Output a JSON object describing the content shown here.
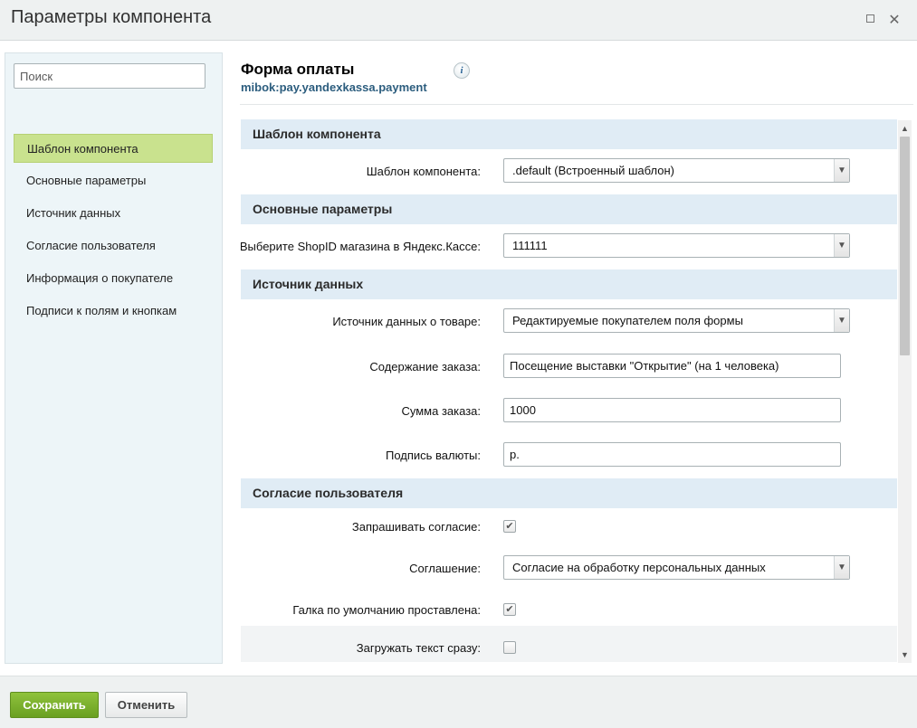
{
  "window": {
    "title": "Параметры компонента"
  },
  "sidebar": {
    "search_placeholder": "Поиск",
    "items": [
      {
        "label": "Шаблон компонента"
      },
      {
        "label": "Основные параметры"
      },
      {
        "label": "Источник данных"
      },
      {
        "label": "Согласие пользователя"
      },
      {
        "label": "Информация о покупателе"
      },
      {
        "label": "Подписи к полям и кнопкам"
      }
    ]
  },
  "component": {
    "title": "Форма оплаты",
    "code": "mibok:pay.yandexkassa.payment",
    "info_icon_glyph": "i"
  },
  "form": {
    "sections": [
      {
        "title": "Шаблон компонента"
      },
      {
        "title": "Основные параметры"
      },
      {
        "title": "Источник данных"
      },
      {
        "title": "Согласие пользователя"
      }
    ],
    "template": {
      "label": "Шаблон компонента:",
      "value": ".default (Встроенный шаблон)"
    },
    "shop_id": {
      "label": "Выберите ShopID магазина в Яндекс.Кассе:",
      "value": "111111"
    },
    "product_source": {
      "label": "Источник данных о товаре:",
      "value": "Редактируемые покупателем поля формы"
    },
    "order_content": {
      "label": "Содержание заказа:",
      "value": "Посещение выставки \"Открытие\" (на 1 человека)"
    },
    "order_sum": {
      "label": "Сумма заказа:",
      "value": "1000"
    },
    "currency_label": {
      "label": "Подпись валюты:",
      "value": "р."
    },
    "ask_consent": {
      "label": "Запрашивать согласие:",
      "checked": true
    },
    "agreement": {
      "label": "Соглашение:",
      "value": "Согласие на обработку персональных данных"
    },
    "default_checked": {
      "label": "Галка по умолчанию проставлена:",
      "checked": true
    },
    "load_text": {
      "label": "Загружать текст сразу:",
      "checked": false
    }
  },
  "footer": {
    "save_label": "Сохранить",
    "cancel_label": "Отменить"
  },
  "colors": {
    "active_nav": "#c9e28e",
    "section_header": "#e0ecf5",
    "save_button": "#7ab030",
    "code_link": "#2c5d7e"
  },
  "icons": {
    "maximize": "maximize-icon",
    "close": "close-icon",
    "info": "info-icon",
    "dropdown": "chevron-down-icon",
    "check": "checkmark-icon"
  }
}
